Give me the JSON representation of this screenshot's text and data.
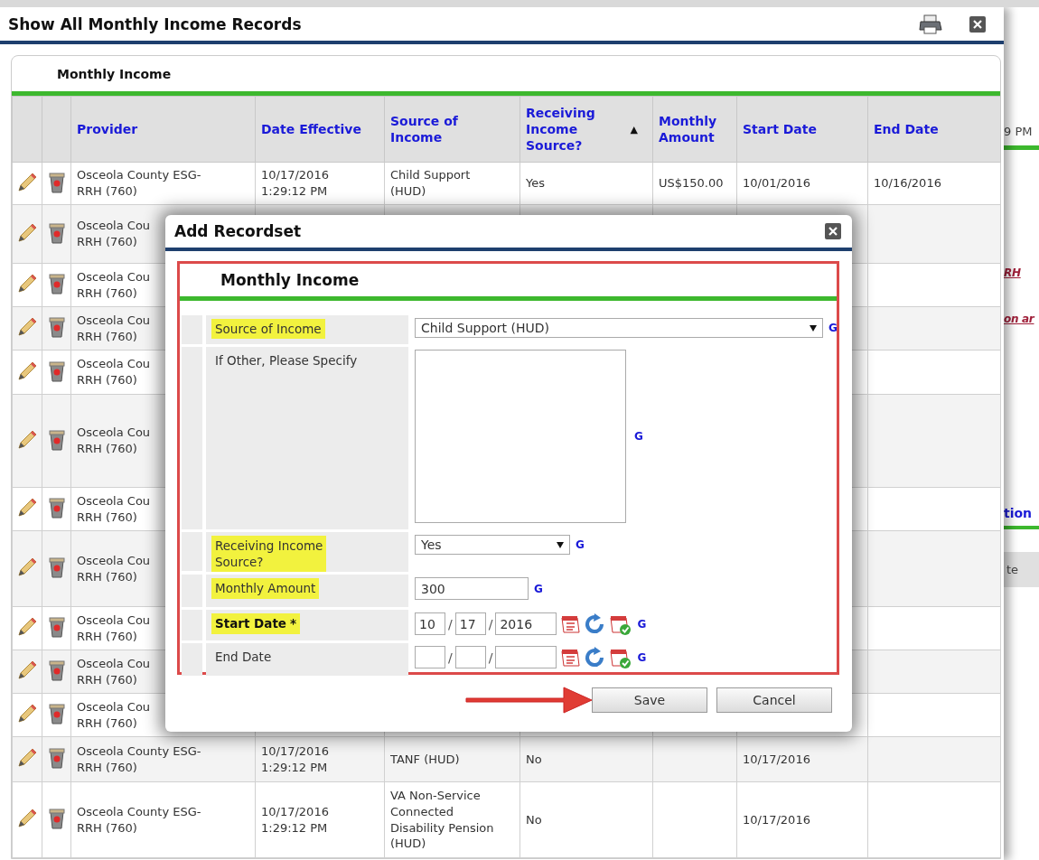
{
  "dialog": {
    "title": "Show All Monthly Income Records"
  },
  "panel": {
    "title": "Monthly Income"
  },
  "table": {
    "columns": [
      {
        "label": "Provider"
      },
      {
        "label": "Date Effective"
      },
      {
        "label": "Source of\nIncome"
      },
      {
        "label": "Receiving\nIncome\nSource?",
        "sort_icon": "▲"
      },
      {
        "label": "Monthly\nAmount"
      },
      {
        "label": "Start Date"
      },
      {
        "label": "End Date"
      }
    ],
    "rows": [
      {
        "provider": "Osceola County ESG-\nRRH (760)",
        "date_effective": "10/17/2016\n1:29:12 PM",
        "source": "Child Support\n(HUD)",
        "receiving": "Yes",
        "amount": "US$150.00",
        "start_date": "10/01/2016",
        "end_date": "10/16/2016"
      },
      {
        "provider": "Osceola Cou\nRRH (760)"
      },
      {
        "provider": "Osceola Cou\nRRH (760)"
      },
      {
        "provider": "Osceola Cou\nRRH (760)"
      },
      {
        "provider": "Osceola Cou\nRRH (760)"
      },
      {
        "provider": "Osceola Cou\nRRH (760)"
      },
      {
        "provider": "Osceola Cou\nRRH (760)"
      },
      {
        "provider": "Osceola Cou\nRRH (760)"
      },
      {
        "provider": "Osceola Cou\nRRH (760)"
      },
      {
        "provider": "Osceola Cou\nRRH (760)"
      },
      {
        "provider": "Osceola Cou\nRRH (760)"
      },
      {
        "provider": "Osceola County ESG-\nRRH (760)",
        "date_effective": "10/17/2016\n1:29:12 PM",
        "source": "TANF (HUD)",
        "receiving": "No",
        "start_date": "10/17/2016"
      },
      {
        "provider": "Osceola County ESG-\nRRH (760)",
        "date_effective": "10/17/2016\n1:29:12 PM",
        "source": "VA Non-Service\nConnected\nDisability Pension\n(HUD)",
        "receiving": "No",
        "start_date": "10/17/2016"
      }
    ]
  },
  "modal": {
    "title": "Add Recordset",
    "panel_title": "Monthly Income",
    "fields": [
      {
        "kind": "select",
        "label": "Source of Income",
        "highlighted": true,
        "value": "Child Support (HUD)",
        "g": "G"
      },
      {
        "kind": "textarea",
        "label": "If Other, Please Specify",
        "highlighted": false,
        "g": "G"
      },
      {
        "kind": "select",
        "label": "Receiving Income\nSource?",
        "highlighted": true,
        "value": "Yes",
        "g": "G"
      },
      {
        "kind": "text",
        "label": "Monthly Amount",
        "highlighted": true,
        "value": "300",
        "g": "G"
      },
      {
        "kind": "date",
        "label": "Start Date",
        "required_mark": "*",
        "highlighted": true,
        "month": "10",
        "day": "17",
        "year": "2016",
        "separators": [
          "/",
          "/"
        ],
        "g": "G"
      },
      {
        "kind": "date",
        "label": "End Date",
        "highlighted": false,
        "separators": [
          "/",
          "/"
        ],
        "g": "G"
      }
    ],
    "buttons": [
      {
        "label": "Save"
      },
      {
        "label": "Cancel"
      }
    ]
  },
  "background_page": {
    "items": [
      {
        "kind": "text",
        "text": "9 PM"
      },
      {
        "kind": "link",
        "text": "RH"
      },
      {
        "kind": "link",
        "text": "on ar"
      },
      {
        "kind": "heading",
        "text": "tion"
      },
      {
        "kind": "column",
        "text": "te"
      }
    ]
  }
}
